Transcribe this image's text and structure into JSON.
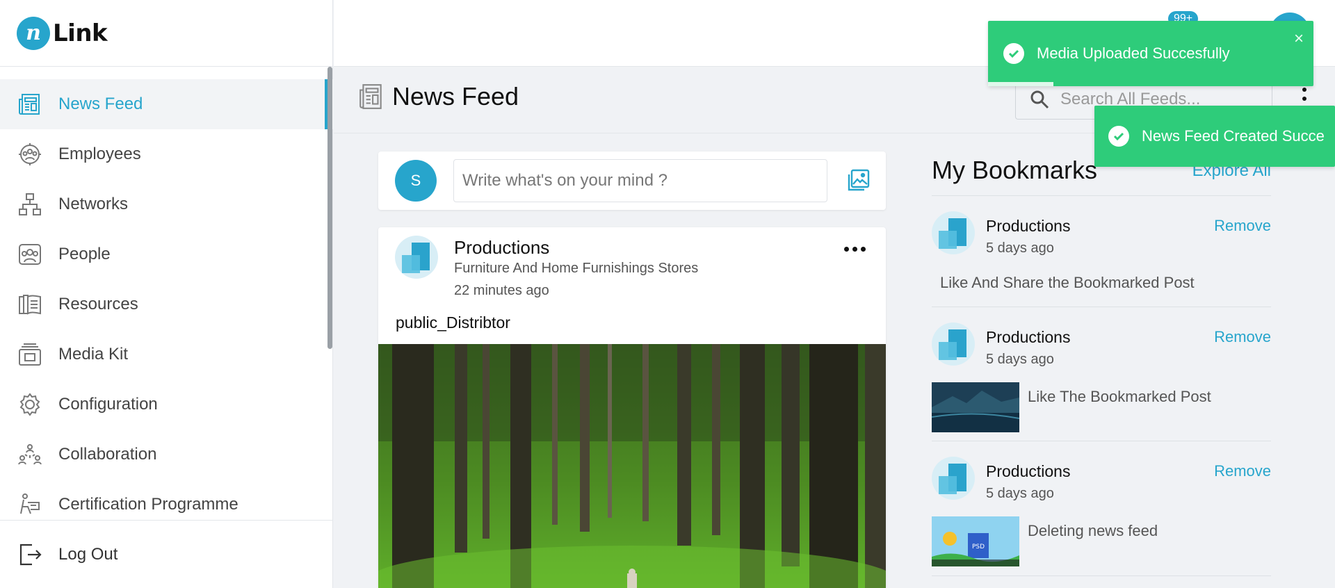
{
  "brand": {
    "logo_letter": "n",
    "name": "Link"
  },
  "sidebar": {
    "items": [
      {
        "label": "News Feed",
        "icon": "newspaper-icon",
        "active": true
      },
      {
        "label": "Employees",
        "icon": "employees-icon"
      },
      {
        "label": "Networks",
        "icon": "network-icon"
      },
      {
        "label": "People",
        "icon": "people-icon"
      },
      {
        "label": "Resources",
        "icon": "book-icon"
      },
      {
        "label": "Media Kit",
        "icon": "media-kit-icon"
      },
      {
        "label": "Configuration",
        "icon": "gear-icon"
      },
      {
        "label": "Collaboration",
        "icon": "collaboration-icon"
      },
      {
        "label": "Certification Programme",
        "icon": "certification-icon"
      }
    ],
    "logout_label": "Log Out"
  },
  "topbar": {
    "notification_count": "99+"
  },
  "page": {
    "title": "News Feed",
    "search_placeholder": "Search All Feeds..."
  },
  "composer": {
    "avatar_initial": "S",
    "placeholder": "Write what's on your mind ?"
  },
  "post": {
    "author": "Productions",
    "category": "Furniture And Home Furnishings Stores",
    "time": "22 minutes ago",
    "text": "public_Distribtor"
  },
  "bookmarks": {
    "title": "My Bookmarks",
    "explore_label": "Explore All",
    "items": [
      {
        "name": "Productions",
        "time": "5 days ago",
        "remove": "Remove",
        "text": "Like And Share the Bookmarked Post"
      },
      {
        "name": "Productions",
        "time": "5 days ago",
        "remove": "Remove",
        "text": "Like The Bookmarked Post"
      },
      {
        "name": "Productions",
        "time": "5 days ago",
        "remove": "Remove",
        "text": "Deleting news feed",
        "thumb_label": "PSD"
      }
    ]
  },
  "toasts": [
    {
      "message": "Media Uploaded Succesfully",
      "close": "×"
    },
    {
      "message": "News Feed Created Succe"
    }
  ],
  "colors": {
    "accent": "#27a5cc",
    "toast": "#2ecc7a"
  }
}
